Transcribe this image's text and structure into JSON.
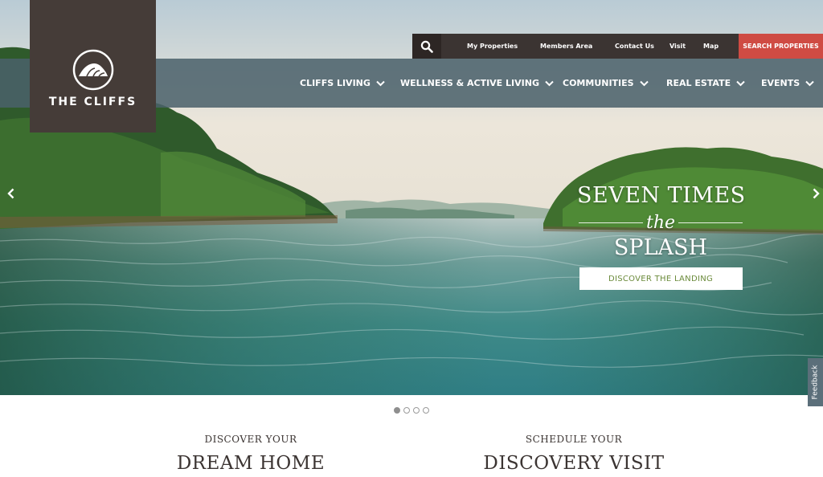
{
  "brand": {
    "name": "THE CLIFFS"
  },
  "utility_nav": {
    "search_icon": "search-icon",
    "links": [
      "My Properties",
      "Members Area",
      "Contact Us",
      "Visit",
      "Map"
    ],
    "cta": "SEARCH PROPERTIES"
  },
  "main_nav": {
    "items": [
      "CLIFFS LIVING",
      "WELLNESS & ACTIVE LIVING",
      "COMMUNITIES",
      "REAL ESTATE",
      "EVENTS"
    ]
  },
  "hero": {
    "line1": "SEVEN TIMES",
    "line2": "the",
    "line3": "SPLASH",
    "button": "DISCOVER THE LANDING",
    "slide_count": 4,
    "active_slide": 1
  },
  "feedback": {
    "label": "Feedback"
  },
  "ctas": [
    {
      "small": "DISCOVER YOUR",
      "big": "DREAM HOME"
    },
    {
      "small": "SCHEDULE YOUR",
      "big": "DISCOVERY VISIT"
    }
  ],
  "colors": {
    "logo_bg": "#453c38",
    "nav_bg": "#4a616a",
    "cta_red": "#cf4b43",
    "button_text_green": "#6a8a3a"
  }
}
